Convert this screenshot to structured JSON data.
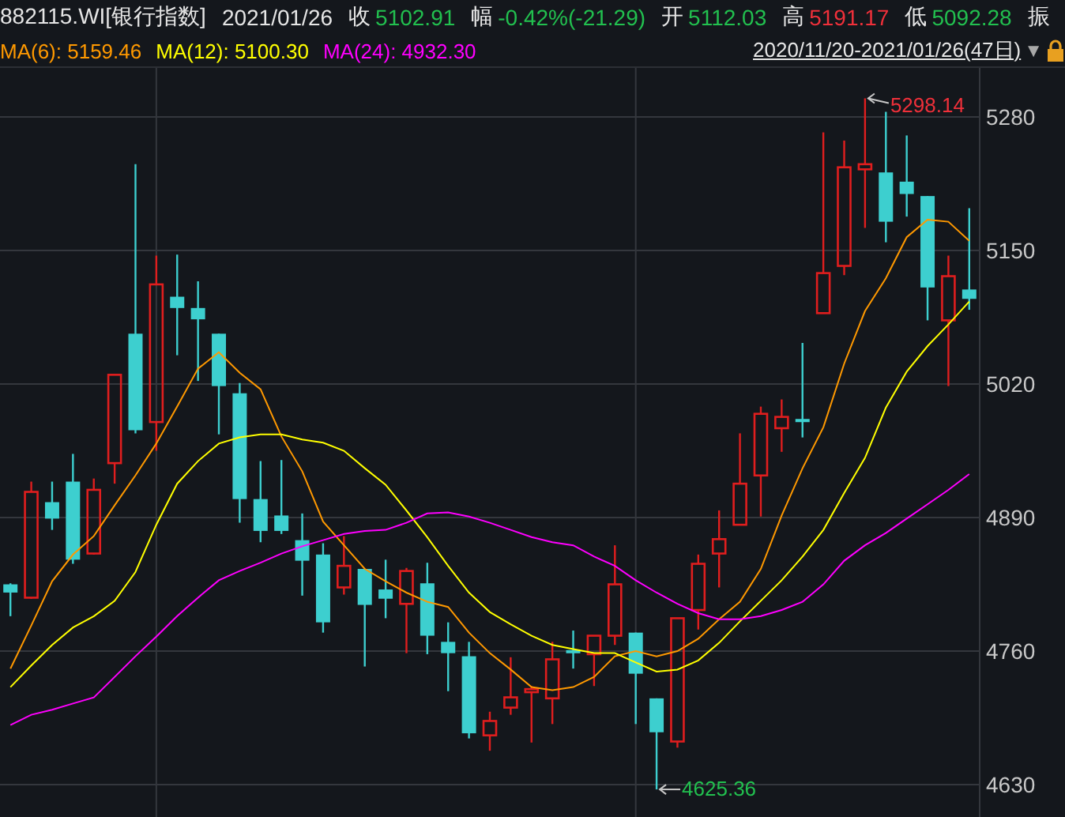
{
  "header": {
    "symbol": "882115.WI[银行指数]",
    "date": "2021/01/26",
    "quotes": [
      {
        "label": "收",
        "value": "5102.91",
        "color": "#22c04f"
      },
      {
        "label": "幅",
        "value": "-0.42%(-21.29)",
        "color": "#22c04f"
      },
      {
        "label": "开",
        "value": "5112.03",
        "color": "#22c04f"
      },
      {
        "label": "高",
        "value": "5191.17",
        "color": "#f0303a"
      },
      {
        "label": "低",
        "value": "5092.28",
        "color": "#22c04f"
      },
      {
        "label": "振"
      }
    ]
  },
  "legend": {
    "items": [
      {
        "text": "MA(6): 5159.46",
        "color": "#ff9900"
      },
      {
        "text": "MA(12): 5100.30",
        "color": "#ffff00"
      },
      {
        "text": "MA(24): 4932.30",
        "color": "#ff00ff"
      }
    ],
    "date_range": "2020/11/20-2021/01/26(47日)",
    "dropdown_glyph": "▼"
  },
  "chart": {
    "chart_data": {
      "type": "candlestick",
      "grid": true,
      "categories": [
        null,
        null,
        null,
        null,
        null,
        null,
        null,
        null,
        null,
        null,
        null,
        null,
        null,
        null,
        null,
        null,
        null,
        null,
        null,
        null,
        null,
        null,
        null,
        null,
        null,
        null,
        null,
        null,
        null,
        null,
        null,
        null,
        null,
        null,
        null,
        null,
        null,
        null,
        null,
        null,
        null,
        null,
        null,
        null,
        null,
        null,
        null
      ],
      "ylim": [
        4598.5,
        5327.7
      ],
      "yticks": [
        4630,
        4760,
        4890,
        5020,
        5150,
        5280
      ],
      "series": [
        {
          "type": "line",
          "color": "#ff9900",
          "values": [
            4743,
            4785,
            4828,
            4854,
            4872,
            4902,
            4931,
            4962,
            4998,
            5035,
            5051,
            5031,
            5015,
            4969,
            4935,
            4886,
            4863,
            4840,
            4828,
            4817,
            4808,
            4803,
            4778,
            4758,
            4742,
            4725,
            4722,
            4725,
            4735,
            4755,
            4760,
            4755,
            4760,
            4772,
            4791,
            4808,
            4840,
            4892,
            4938,
            4978,
            5040,
            5091,
            5123,
            5163,
            5180,
            5178,
            5159.46
          ]
        },
        {
          "type": "line",
          "color": "#ffff00",
          "values": [
            4725,
            4746,
            4766,
            4783,
            4794,
            4809,
            4837,
            4883,
            4923,
            4945,
            4962,
            4968,
            4971,
            4971,
            4966,
            4963,
            4955,
            4938,
            4922,
            4897,
            4871,
            4843,
            4817,
            4798,
            4786,
            4775,
            4766,
            4762,
            4758,
            4758,
            4749,
            4740,
            4742,
            4751,
            4768,
            4789,
            4809,
            4829,
            4852,
            4878,
            4914,
            4948,
            4997,
            5032,
            5057,
            5078,
            5100.3
          ]
        },
        {
          "type": "line",
          "color": "#ff00ff",
          "values": [
            4688,
            4698,
            4703,
            4709,
            4715,
            4735,
            4755,
            4774,
            4794,
            4812,
            4829,
            4838,
            4846,
            4855,
            4862,
            4868,
            4874,
            4877,
            4878,
            4885,
            4894,
            4895,
            4891,
            4885,
            4878,
            4871,
            4866,
            4863,
            4852,
            4843,
            4829,
            4817,
            4806,
            4797,
            4791,
            4791,
            4794,
            4800,
            4808,
            4825,
            4848,
            4863,
            4875,
            4889,
            4903,
            4917,
            4932.3
          ]
        }
      ],
      "ohlc": [
        [
          4825,
          4826,
          4794,
          4817
        ],
        [
          4812,
          4925,
          4811,
          4915
        ],
        [
          4905,
          4925,
          4878,
          4889
        ],
        [
          4925,
          4952,
          4845,
          4849
        ],
        [
          4855,
          4928,
          4854,
          4917
        ],
        [
          4943,
          5029,
          4923,
          5029
        ],
        [
          5069,
          5234,
          4972,
          4975
        ],
        [
          4983,
          5145,
          4955,
          5117
        ],
        [
          5105,
          5146,
          5048,
          5094
        ],
        [
          5094,
          5120,
          5023,
          5083
        ],
        [
          5069,
          5069,
          4971,
          5018
        ],
        [
          5011,
          5021,
          4885,
          4908
        ],
        [
          4908,
          4945,
          4866,
          4877
        ],
        [
          4892,
          4946,
          4874,
          4877
        ],
        [
          4868,
          4894,
          4814,
          4848
        ],
        [
          4854,
          4865,
          4778,
          4788
        ],
        [
          4822,
          4872,
          4815,
          4843
        ],
        [
          4840,
          4840,
          4745,
          4805
        ],
        [
          4820,
          4849,
          4792,
          4811
        ],
        [
          4806,
          4841,
          4758,
          4838
        ],
        [
          4826,
          4846,
          4757,
          4775
        ],
        [
          4769,
          4788,
          4721,
          4758
        ],
        [
          4755,
          4769,
          4675,
          4680
        ],
        [
          4678,
          4701,
          4663,
          4692
        ],
        [
          4705,
          4754,
          4698,
          4715
        ],
        [
          4720,
          4726,
          4671,
          4723
        ],
        [
          4714,
          4769,
          4689,
          4752
        ],
        [
          4761,
          4780,
          4743,
          4760
        ],
        [
          4757,
          4775,
          4726,
          4775
        ],
        [
          4775,
          4863,
          4766,
          4825
        ],
        [
          4778,
          4778,
          4689,
          4738
        ],
        [
          4714,
          4714,
          4625.36,
          4681
        ],
        [
          4672,
          4792,
          4666,
          4792
        ],
        [
          4800,
          4854,
          4781,
          4845
        ],
        [
          4855,
          4897,
          4822,
          4869
        ],
        [
          4883,
          4972,
          4883,
          4923
        ],
        [
          4931,
          4998,
          4891,
          4991
        ],
        [
          4977,
          5005,
          4954,
          4988
        ],
        [
          4986,
          5060,
          4968,
          4985
        ],
        [
          5089,
          5265,
          5089,
          5128
        ],
        [
          5135,
          5257,
          5126,
          5231
        ],
        [
          5229,
          5298.14,
          5172,
          5234
        ],
        [
          5226,
          5285,
          5158,
          5178
        ],
        [
          5217,
          5262,
          5183,
          5205
        ],
        [
          5203,
          5203,
          5082,
          5114
        ],
        [
          5082,
          5145,
          5018,
          5125
        ],
        [
          5112.03,
          5191.17,
          5092.28,
          5102.91
        ]
      ],
      "annotations": [
        {
          "text": "5298.14"
        },
        {
          "text": "4625.36"
        }
      ]
    }
  }
}
